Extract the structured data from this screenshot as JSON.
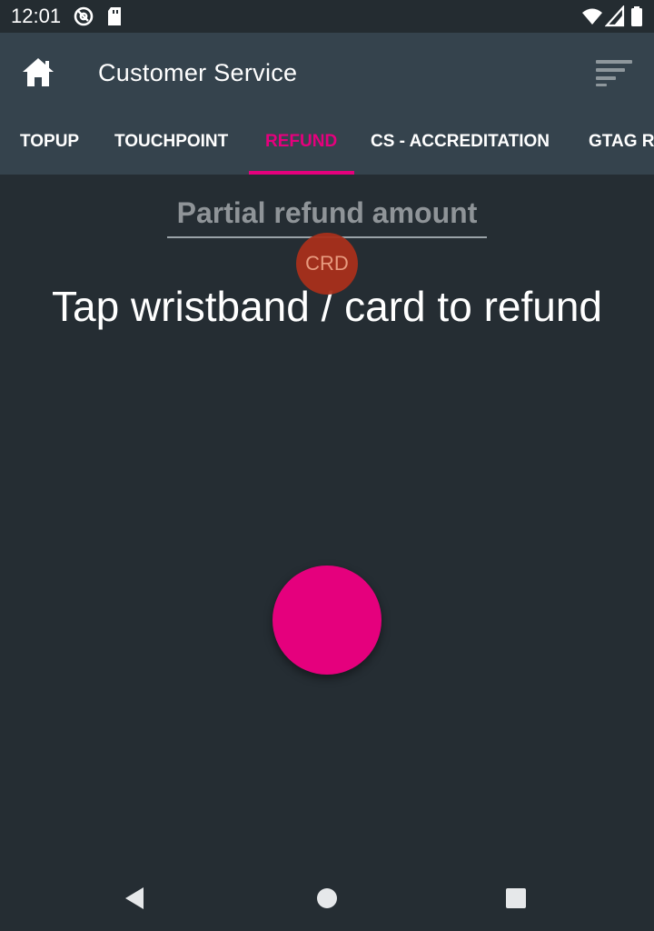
{
  "status_bar": {
    "time": "12:01",
    "icons": [
      "at-sign-icon",
      "sd-card-icon",
      "wifi-icon",
      "cell-signal-icon",
      "battery-icon"
    ]
  },
  "app_bar": {
    "title": "Customer Service",
    "home_icon": "home-icon",
    "filter_icon": "filter-sort-icon"
  },
  "tabs": [
    {
      "label": "TOPUP",
      "active": false
    },
    {
      "label": "TOUCHPOINT",
      "active": false
    },
    {
      "label": "REFUND",
      "active": true
    },
    {
      "label": "CS - ACCREDITATION",
      "active": false
    },
    {
      "label": "GTAG R",
      "active": false
    }
  ],
  "refund": {
    "amount_placeholder": "Partial refund amount",
    "badge": "CRD",
    "instruction": "Tap wristband / card to refund"
  },
  "nav_bar": {
    "back_icon": "back-triangle-icon",
    "home_icon": "home-circle-icon",
    "recents_icon": "recents-square-icon"
  },
  "colors": {
    "background": "#252d33",
    "app_bar": "#35434d",
    "accent": "#e5007d",
    "badge": "#a8301b"
  }
}
